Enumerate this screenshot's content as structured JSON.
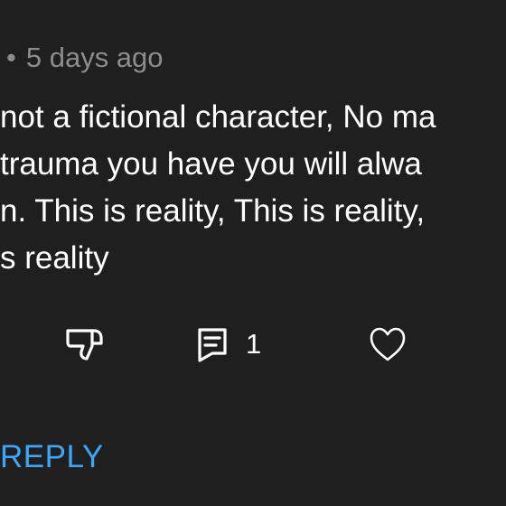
{
  "comment": {
    "meta": {
      "separator": "•",
      "timestamp": "5 days ago"
    },
    "text_lines": [
      "not a fictional character, No ma",
      "trauma you have you will alwa",
      "n. This is reality, This is reality,",
      "s reality"
    ],
    "actions": {
      "dislike_icon": "thumbs-down-icon",
      "replies_icon": "comment-icon",
      "reply_count": "1",
      "like_icon": "heart-icon"
    },
    "reply_label": "REPLY"
  },
  "colors": {
    "background": "#1f1f1f",
    "text": "#ffffff",
    "meta_text": "#8c8c8c",
    "accent": "#3ea6ff"
  }
}
